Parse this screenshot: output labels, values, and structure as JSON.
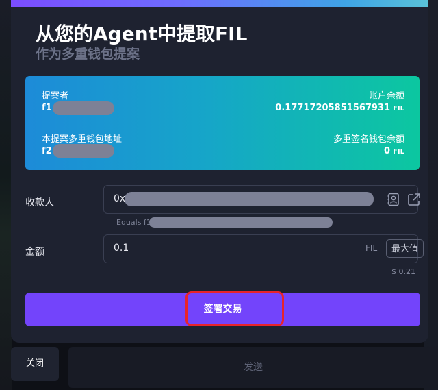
{
  "modal": {
    "title": "从您的Agent中提取FIL",
    "subtitle": "作为多重钱包提案"
  },
  "card": {
    "proposer_label": "提案者",
    "proposer_prefix": "f1",
    "balance_label": "账户余额",
    "balance_value": "0.17717205851567931",
    "balance_unit": "FIL",
    "multisig_address_label": "本提案多重钱包地址",
    "multisig_prefix": "f2",
    "multisig_balance_label": "多重签名钱包余额",
    "multisig_balance_value": "0",
    "multisig_balance_unit": "FIL"
  },
  "form": {
    "recipient_label": "收款人",
    "recipient_prefix": "0x",
    "equals_text": "Equals f1",
    "amount_label": "金额",
    "amount_value": "0.1",
    "amount_unit": "FIL",
    "max_label": "最大值",
    "usd_value": "$ 0.21"
  },
  "actions": {
    "sign_label": "签署交易",
    "close_label": "关闭",
    "send_label": "发送"
  },
  "colors": {
    "accent_purple": "#7344fb",
    "highlight_red": "#e8242b",
    "card_gradient_start": "#1d8bd8",
    "card_gradient_end": "#0cc7a0"
  },
  "icons": [
    "contact-book-icon",
    "external-link-icon"
  ]
}
